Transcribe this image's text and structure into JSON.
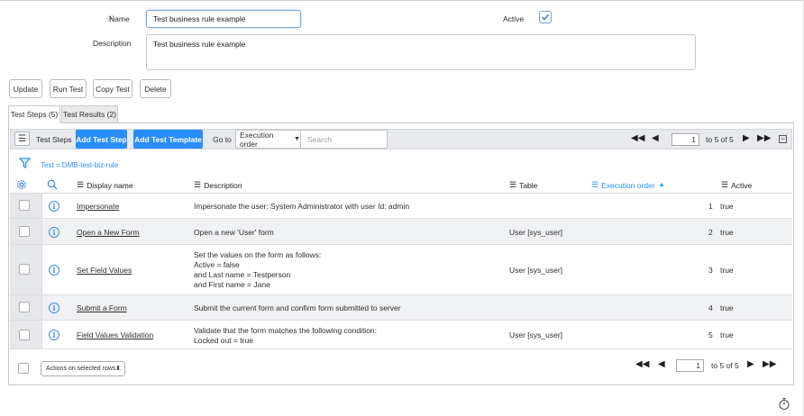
{
  "form": {
    "name_label": "Name",
    "name_value": "Test business rule example",
    "active_label": "Active",
    "active_checked": true,
    "description_label": "Description",
    "description_value": "Test business rule example"
  },
  "actions": {
    "update": "Update",
    "run_test": "Run Test",
    "copy_test": "Copy Test",
    "delete": "Delete"
  },
  "tabs": [
    {
      "label": "Test Steps (5)",
      "active": true
    },
    {
      "label": "Test Results (2)",
      "active": false
    }
  ],
  "toolbar": {
    "list_label": "Test Steps",
    "add_step": "Add Test Step",
    "add_template": "Add Test Template",
    "goto_label": "Go to",
    "goto_value": "Execution order",
    "search_placeholder": "Search",
    "page_value": "1",
    "page_text": "to 5 of 5"
  },
  "filter": {
    "breadcrumb": "Test = DMB-test-biz-rule"
  },
  "columns": {
    "display_name": "Display name",
    "description": "Description",
    "table": "Table",
    "execution_order": "Execution order",
    "active": "Active"
  },
  "rows": [
    {
      "name": "Impersonate",
      "description": [
        "Impersonate the user: System Administrator with user Id: admin"
      ],
      "table": "",
      "order": "1",
      "active": "true"
    },
    {
      "name": "Open a New Form",
      "description": [
        "Open a new 'User' form"
      ],
      "table": "User [sys_user]",
      "order": "2",
      "active": "true"
    },
    {
      "name": "Set Field Values",
      "description": [
        "Set the values on the form as follows:",
        "Active = false",
        "and Last name = Testperson",
        "and First name = Jane"
      ],
      "table": "User [sys_user]",
      "order": "3",
      "active": "true"
    },
    {
      "name": "Submit a Form",
      "description": [
        "Submit the current form and confirm form submitted to server"
      ],
      "table": "",
      "order": "4",
      "active": "true"
    },
    {
      "name": "Field Values Validation",
      "description": [
        "Validate that the form matches the following condition:",
        "Locked out = true"
      ],
      "table": "User [sys_user]",
      "order": "5",
      "active": "true"
    }
  ],
  "footer": {
    "actions_select": "Actions on selected rows...",
    "page_value": "1",
    "page_text": "to 5 of 5"
  },
  "icons": {
    "required": "required-star-icon",
    "check": "checkmark-icon",
    "menu": "hamburger-menu-icon",
    "filter": "funnel-filter-icon",
    "gear": "gear-icon",
    "search": "magnifier-search-icon",
    "info": "info-circle-icon",
    "timer": "stopwatch-icon"
  },
  "colors": {
    "accent": "#278efc",
    "toolbar_bg": "#e7e9ed"
  }
}
